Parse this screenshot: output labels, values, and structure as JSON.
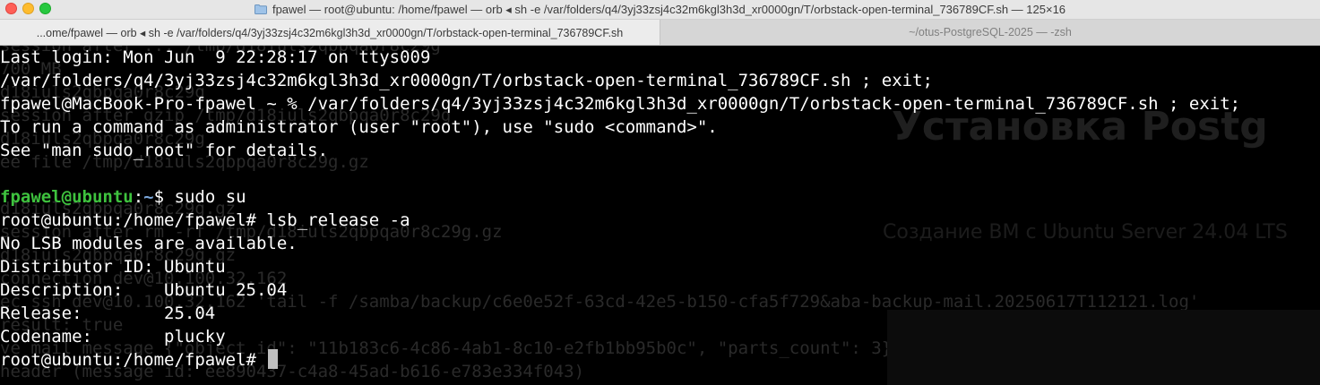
{
  "window": {
    "title": "fpawel — root@ubuntu: /home/fpawel — orb ◂ sh -e /var/folders/q4/3yj33zsj4c32m6kgl3h3d_xr0000gn/T/orbstack-open-terminal_736789CF.sh — 125×16"
  },
  "tabs": [
    {
      "label": "...ome/fpawel — orb ◂ sh -e /var/folders/q4/3yj33zsj4c32m6kgl3h3d_xr0000gn/T/orbstack-open-terminal_736789CF.sh",
      "active": true
    },
    {
      "label": "~/otus-PostgreSQL-2025 — -zsh",
      "active": false
    }
  ],
  "terminal": {
    "lines": [
      "Last login: Mon Jun  9 22:28:17 on ttys009",
      "/var/folders/q4/3yj33zsj4c32m6kgl3h3d_xr0000gn/T/orbstack-open-terminal_736789CF.sh ; exit;",
      "fpawel@MacBook-Pro-fpawel ~ % /var/folders/q4/3yj33zsj4c32m6kgl3h3d_xr0000gn/T/orbstack-open-terminal_736789CF.sh ; exit;",
      "To run a command as administrator (user \"root\"), use \"sudo <command>\".",
      "See \"man sudo_root\" for details.",
      "",
      "",
      "root@ubuntu:/home/fpawel# lsb_release -a",
      "No LSB modules are available.",
      "Distributor ID:\tUbuntu",
      "Description:    Ubuntu 25.04",
      "Release:        25.04",
      "Codename:       plucky",
      "root@ubuntu:/home/fpawel# "
    ],
    "prompt_user": "fpawel@ubuntu",
    "prompt_sep": ":",
    "prompt_path": "~",
    "prompt_cmd": "$ sudo su",
    "ghost_lines": [
      "session after ... /tmp/d18iuls2qbpqa0r8c29g",
      "700 MB",
      "d18iuls2qbpqa0r8c29g",
      "session after gzip /tmp/d18iuls2qbpqa0r8c29g",
      "d18iuls2qbpqa0r8c29g",
      "ee file /tmp/d18iuls2qbpqa0r8c29g.gz",
      "d18iuls2qbpqa0r8c29g.gz",
      "session after rm -rf /tmp/d18iuls2qbpqa0r8c29g.gz",
      "d18iuls2qbpqa0r8c29g.gz",
      "connection dev@10.100.32.162",
      "ec ssh dev@10.100.32.162 'tail -f /samba/backup/c6e0e52f-63cd-42e5-b150-cfa5f729&aba-backup-mail.20250617T112121.log'",
      "result: true",
      "ve mail message {\"object_id\": \"11b183c6-4c86-4ab1-8c10-e2fb1bb95b0c\", \"parts_count\": 3}",
      "header (message id: ee890437-c4a8-45ad-b616-e783e334f043)"
    ],
    "ghost_heading": "Установка Postg",
    "ghost_sub": "Создание ВМ с Ubuntu Server 24.04 LTS"
  },
  "colors": {
    "prompt_user": "#3ec23e",
    "prompt_path": "#7aa6da",
    "text": "#ffffff",
    "background": "#000000"
  }
}
